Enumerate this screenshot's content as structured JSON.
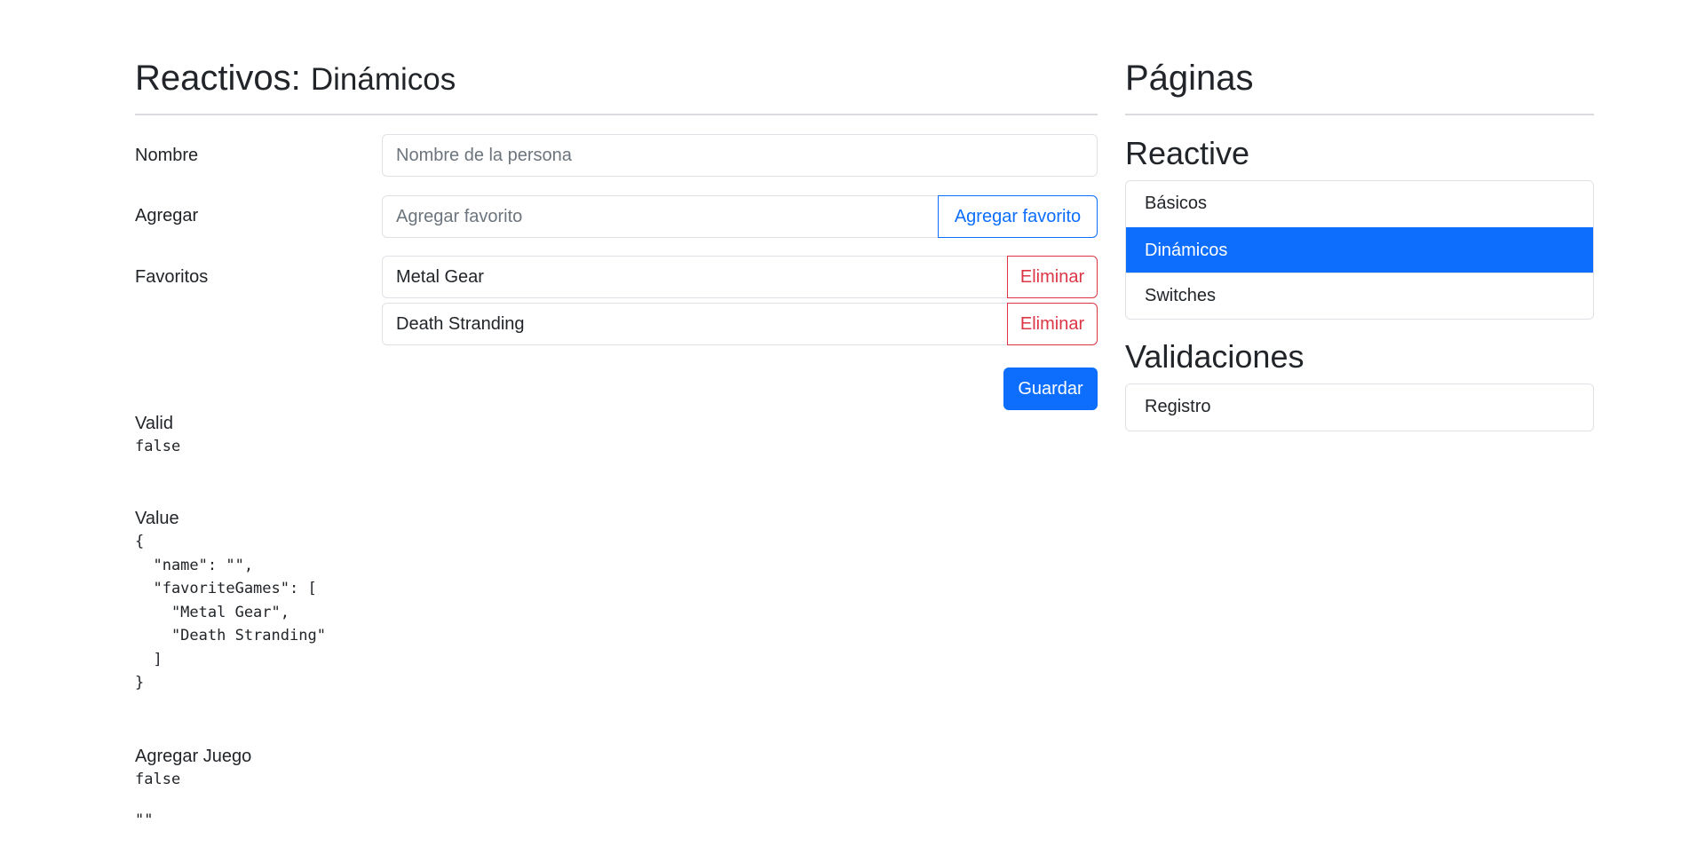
{
  "main": {
    "title": "Reactivos:",
    "subtitle": "Dinámicos",
    "form": {
      "name_label": "Nombre",
      "name_value": "",
      "name_placeholder": "Nombre de la persona",
      "add_label": "Agregar",
      "add_value": "",
      "add_placeholder": "Agregar favorito",
      "add_button": "Agregar favorito",
      "favorites_label": "Favoritos",
      "favorites": [
        {
          "value": "Metal Gear",
          "remove_label": "Eliminar"
        },
        {
          "value": "Death Stranding",
          "remove_label": "Eliminar"
        }
      ],
      "save_button": "Guardar"
    },
    "debug": {
      "valid_label": "Valid",
      "valid_value": "false",
      "value_label": "Value",
      "value_json": "{\n  \"name\": \"\",\n  \"favoriteGames\": [\n    \"Metal Gear\",\n    \"Death Stranding\"\n  ]\n}",
      "add_game_label": "Agregar Juego",
      "add_game_valid": "false",
      "add_game_value": "\"\""
    }
  },
  "sidebar": {
    "title": "Páginas",
    "sections": [
      {
        "title": "Reactive",
        "items": [
          {
            "label": "Básicos",
            "active": false
          },
          {
            "label": "Dinámicos",
            "active": true
          },
          {
            "label": "Switches",
            "active": false
          }
        ]
      },
      {
        "title": "Validaciones",
        "items": [
          {
            "label": "Registro",
            "active": false
          }
        ]
      }
    ]
  },
  "colors": {
    "primary": "#0d6efd",
    "danger": "#dc3545",
    "border": "#dee2e6",
    "text": "#212529",
    "placeholder": "#6c757d"
  }
}
